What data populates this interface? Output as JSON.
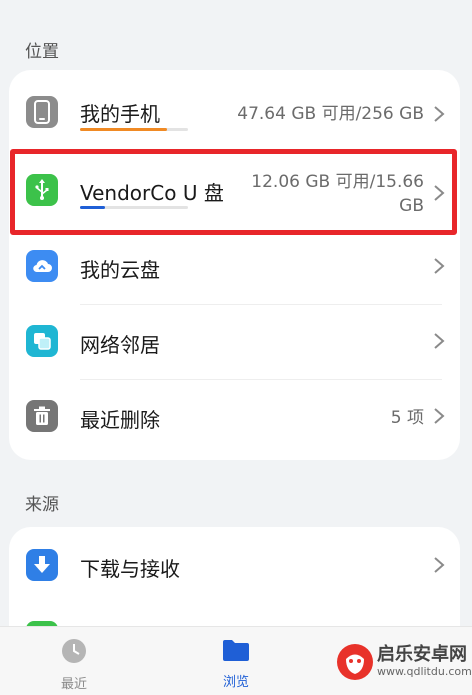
{
  "sections": {
    "location_title": "位置",
    "source_title": "来源"
  },
  "location_items": [
    {
      "label": "我的手机",
      "value": "47.64 GB 可用/256 GB",
      "usage_fraction": 0.81,
      "bar_color": "#f08a24",
      "icon": "phone-icon"
    },
    {
      "label": "VendorCo U 盘",
      "value_line1": "12.06 GB 可用/15.66",
      "value_line2": "GB",
      "usage_fraction": 0.23,
      "bar_color": "#1f5fd6",
      "icon": "usb-icon"
    },
    {
      "label": "我的云盘",
      "icon": "cloud-icon"
    },
    {
      "label": "网络邻居",
      "icon": "network-icon"
    },
    {
      "label": "最近删除",
      "value": "5 项",
      "icon": "trash-icon"
    }
  ],
  "source_items": [
    {
      "label": "下载与接收",
      "icon": "download-icon"
    }
  ],
  "bottom_nav": {
    "recent_label": "最近",
    "browse_label": "浏览"
  },
  "watermark": {
    "brand": "启乐安卓网",
    "url": "www.qdlitdu.com"
  },
  "colors": {
    "accent": "#1f5fd6",
    "highlight": "#e8262a",
    "usb_green": "#3cc24a",
    "cloud_blue": "#3d8cf2",
    "network_cyan": "#1fb6d3",
    "download_blue": "#2f7fe6",
    "trash_gray": "#767676",
    "phone_gray": "#8c8c8c"
  }
}
